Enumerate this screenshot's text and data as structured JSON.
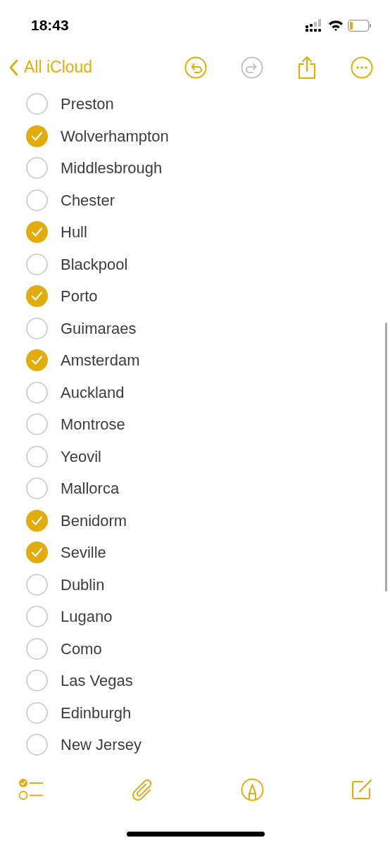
{
  "status_bar": {
    "time": "18:43"
  },
  "nav": {
    "back_label": "All iCloud",
    "undo_enabled": true,
    "redo_enabled": false
  },
  "checklist": [
    {
      "label": "Preston",
      "checked": false
    },
    {
      "label": "Wolverhampton",
      "checked": true
    },
    {
      "label": "Middlesbrough",
      "checked": false
    },
    {
      "label": "Chester",
      "checked": false
    },
    {
      "label": "Hull",
      "checked": true
    },
    {
      "label": "Blackpool",
      "checked": false
    },
    {
      "label": "Porto",
      "checked": true
    },
    {
      "label": "Guimaraes",
      "checked": false
    },
    {
      "label": "Amsterdam",
      "checked": true
    },
    {
      "label": "Auckland",
      "checked": false
    },
    {
      "label": "Montrose",
      "checked": false
    },
    {
      "label": "Yeovil",
      "checked": false
    },
    {
      "label": "Mallorca",
      "checked": false
    },
    {
      "label": "Benidorm",
      "checked": true
    },
    {
      "label": "Seville",
      "checked": true
    },
    {
      "label": "Dublin",
      "checked": false
    },
    {
      "label": "Lugano",
      "checked": false
    },
    {
      "label": "Como",
      "checked": false
    },
    {
      "label": "Las Vegas",
      "checked": false
    },
    {
      "label": "Edinburgh",
      "checked": false
    },
    {
      "label": "New Jersey",
      "checked": false
    }
  ]
}
